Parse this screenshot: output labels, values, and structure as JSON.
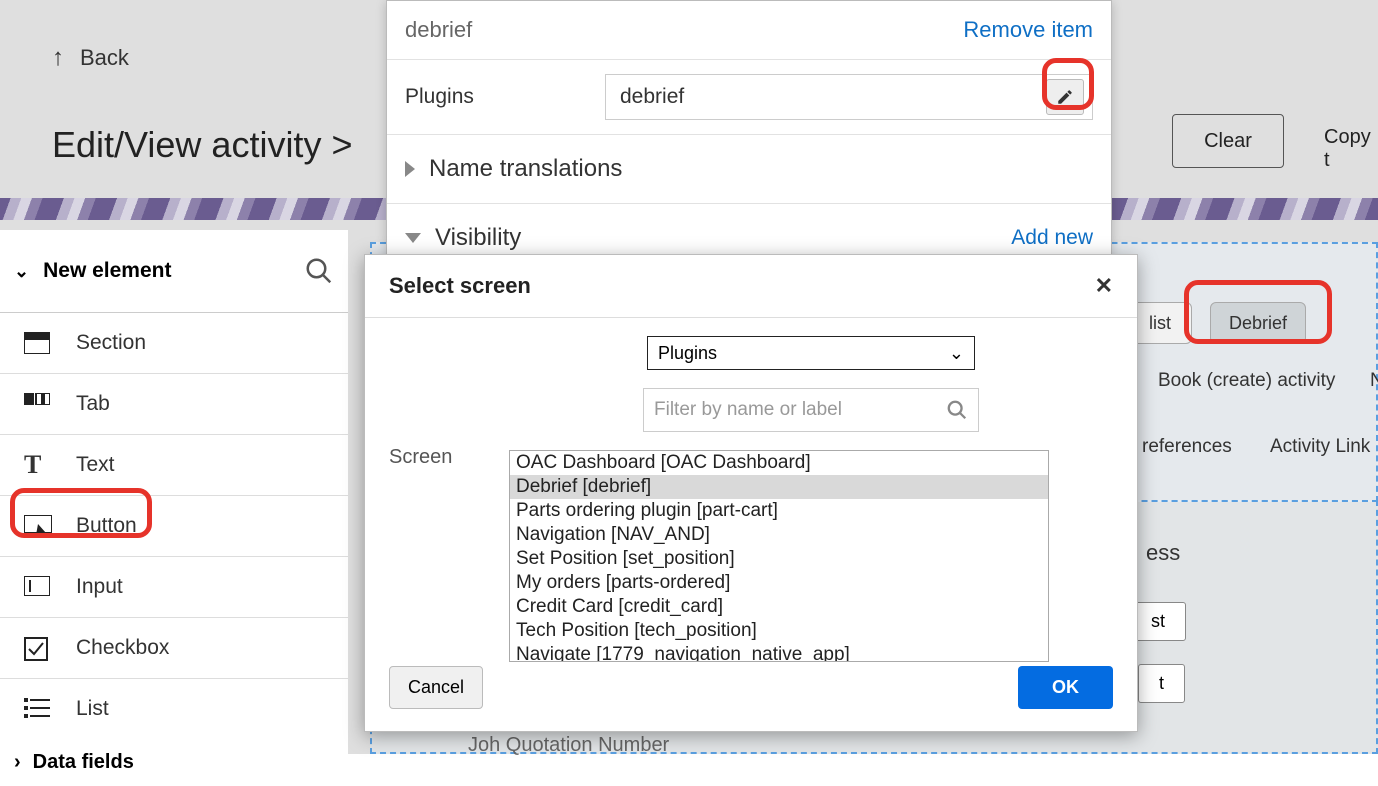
{
  "back": {
    "label": "Back"
  },
  "page": {
    "title": "Edit/View activity >"
  },
  "topbar": {
    "clear": "Clear",
    "copy": "Copy t"
  },
  "dropdown_panel": {
    "item_label": "debrief",
    "remove": "Remove item",
    "plugins_label": "Plugins",
    "plugin_value": "debrief",
    "name_translations": "Name translations",
    "visibility": "Visibility",
    "add_new": "Add new"
  },
  "sidebar": {
    "section_label": "New element",
    "data_fields": "Data fields",
    "items": [
      {
        "id": "section",
        "label": "Section"
      },
      {
        "id": "tab",
        "label": "Tab"
      },
      {
        "id": "text",
        "label": "Text"
      },
      {
        "id": "button",
        "label": "Button"
      },
      {
        "id": "input",
        "label": "Input"
      },
      {
        "id": "checkbox",
        "label": "Checkbox"
      },
      {
        "id": "list",
        "label": "List"
      }
    ]
  },
  "right": {
    "list_tab": "list",
    "debrief": "Debrief",
    "book": "Book (create) activity",
    "n": "N",
    "prefs": "references",
    "activity_link": "Activity Link",
    "ess_suffix": "ess",
    "st_btn": "st",
    "t_btn": "t",
    "job_q": "Joh Quotation Number"
  },
  "dialog": {
    "title": "Select screen",
    "screen_label": "Screen",
    "select_value": "Plugins",
    "filter_placeholder": "Filter by name or label",
    "cancel": "Cancel",
    "ok": "OK",
    "list": [
      "OAC Dashboard [OAC Dashboard]",
      "Debrief [debrief]",
      "Parts ordering plugin [part-cart]",
      "Navigation [NAV_AND]",
      "Set Position [set_position]",
      "My orders [parts-ordered]",
      "Credit Card [credit_card]",
      "Tech Position [tech_position]",
      "Navigate [1779_navigation_native_app]"
    ],
    "selected_index": 1
  }
}
